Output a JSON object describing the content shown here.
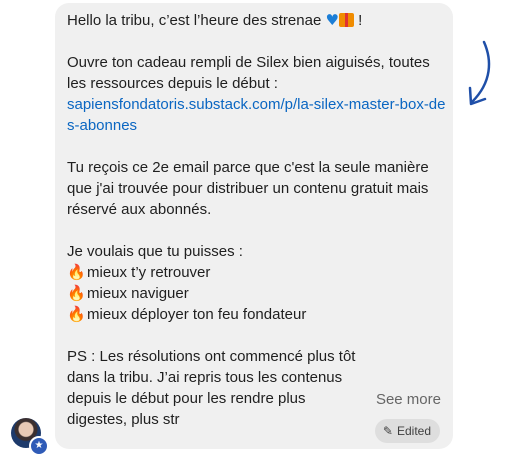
{
  "message": {
    "greeting": "Hello la tribu, c’est l’heure des strenae",
    "greeting_end": "!",
    "para1": "Ouvre ton cadeau rempli de Silex bien aiguisés, toutes les ressources depuis le début :",
    "link": "sapiensfondatoris.substack.com/p/la-silex-master-box-des-abonnes",
    "para2": "Tu reçois ce 2e email parce que c'est la seule manière que j'ai trouvée pour distribuer un contenu gratuit mais réservé aux abonnés.",
    "para3": "Je voulais que tu puisses :",
    "bullets": [
      "mieux t’y retrouver",
      "mieux naviguer",
      "mieux déployer ton feu fondateur"
    ],
    "para4": "PS : Les résolutions ont commencé plus tôt dans la tribu. J’ai repris tous les contenus depuis le début pour les rendre plus digestes, plus str"
  },
  "see_more_label": "See more",
  "edited_label": "Edited",
  "icons": {
    "heart": "blue-heart-icon",
    "gift": "gift-icon",
    "bullet": "fire-icon",
    "edited": "pencil-icon",
    "avatar_badge": "star-badge-icon",
    "annotation": "curved-arrow-icon"
  },
  "colors": {
    "link": "#0a66c2",
    "bubble": "#f0f0f0",
    "arrow": "#1f4fa8"
  }
}
